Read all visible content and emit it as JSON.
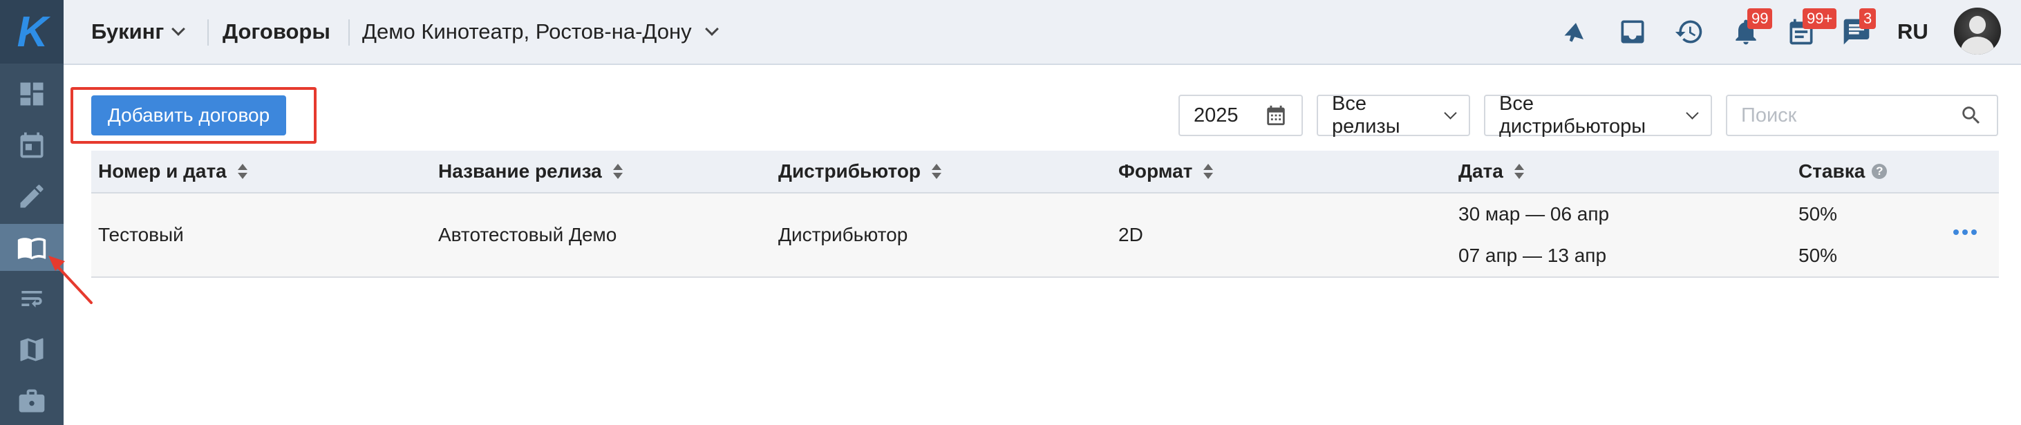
{
  "brand": {
    "logo_letter": "K",
    "logo_color": "#2e8ee6"
  },
  "sidebar": {
    "items": [
      {
        "name": "dashboard-icon",
        "active": false
      },
      {
        "name": "calendar-icon",
        "active": false
      },
      {
        "name": "pencil-icon",
        "active": false
      },
      {
        "name": "book-icon",
        "active": true
      },
      {
        "name": "swap-icon",
        "active": false
      },
      {
        "name": "map-icon",
        "active": false
      },
      {
        "name": "briefcase-icon",
        "active": false
      }
    ]
  },
  "header": {
    "section_label": "Букинг",
    "page_title": "Договоры",
    "cinema": "Демо Кинотеатр, Ростов-на-Дону",
    "icons": [
      {
        "name": "megaphone-icon",
        "badge": ""
      },
      {
        "name": "inbox-icon",
        "badge": ""
      },
      {
        "name": "history-icon",
        "badge": ""
      },
      {
        "name": "bell-icon",
        "badge": "99"
      },
      {
        "name": "tasks-icon",
        "badge": "99+"
      },
      {
        "name": "messages-icon",
        "badge": "3"
      }
    ],
    "language": "RU"
  },
  "toolbar": {
    "add_button_label": "Добавить договор",
    "year_value": "2025",
    "releases_filter": "Все релизы",
    "distributors_filter": "Все дистрибьюторы",
    "search_placeholder": "Поиск"
  },
  "table": {
    "columns": [
      "Номер и дата",
      "Название релиза",
      "Дистрибьютор",
      "Формат",
      "Дата",
      "Ставка"
    ],
    "rows": [
      {
        "number": "Тестовый",
        "release": "Автотестовый Демо",
        "distributor": "Дистрибьютор",
        "format": "2D",
        "periods": [
          {
            "date": "30 мар — 06 апр",
            "rate": "50%"
          },
          {
            "date": "07 апр — 13 апр",
            "rate": "50%"
          }
        ]
      }
    ]
  },
  "colors": {
    "sidebar_bg": "#3a4f63",
    "header_bg": "#edf0f5",
    "primary": "#3d87dc",
    "badge": "#e5463c",
    "annotation": "#e63a2e"
  }
}
